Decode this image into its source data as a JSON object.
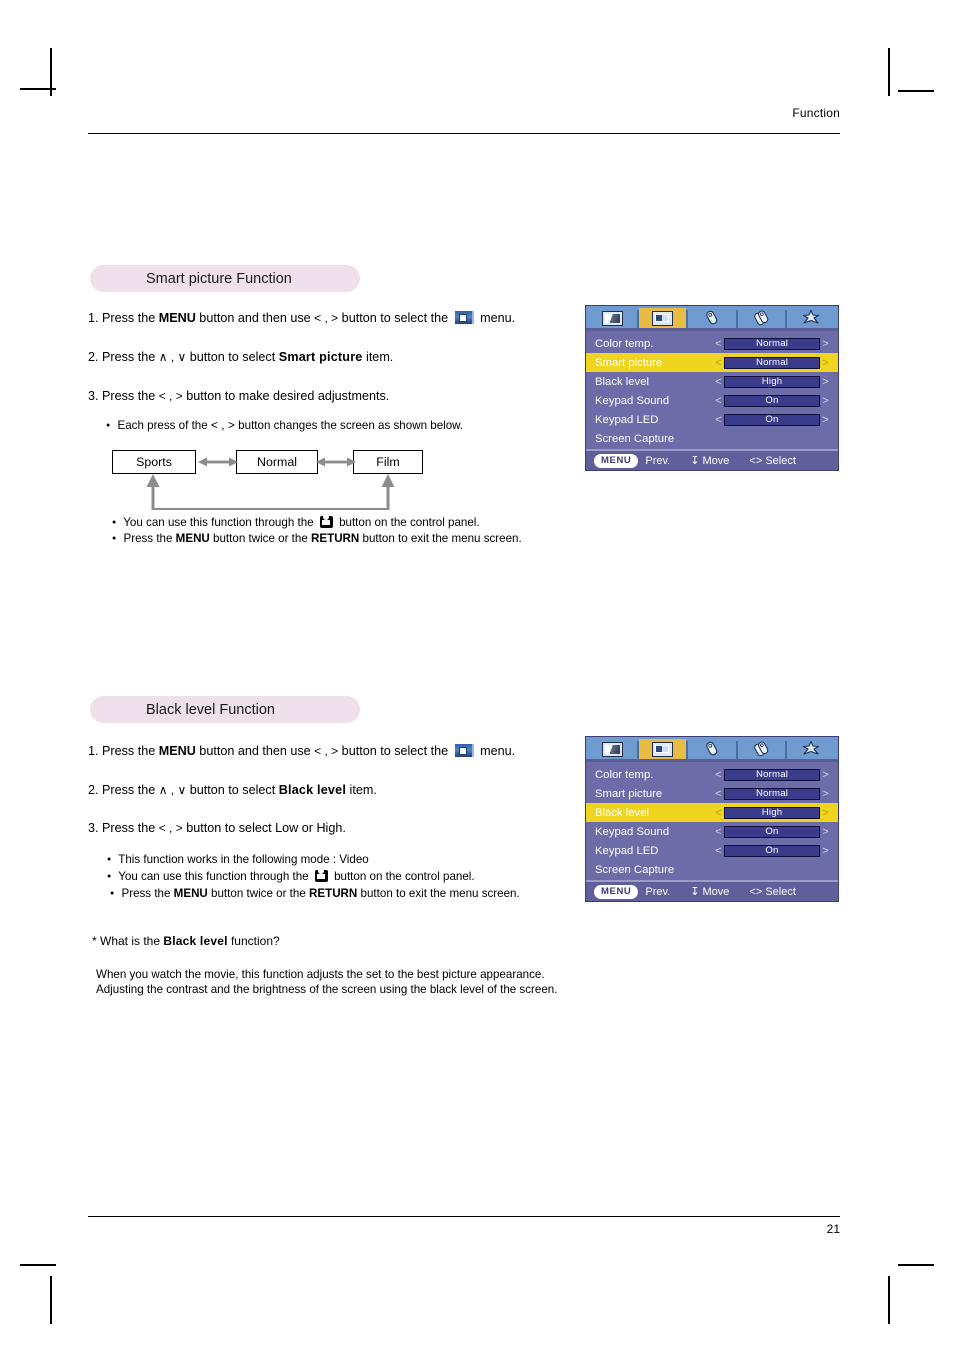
{
  "page": {
    "header_title": "Function",
    "page_number": "21"
  },
  "sections": [
    {
      "id": "smart-picture",
      "pill_title": "Smart picture Function",
      "steps": [
        {
          "num": "1.",
          "pre": "Press the ",
          "bold1": "MENU",
          "mid": " button and then use ",
          "arrows": "< , >",
          "post": " button to select the ",
          "icon": "tv-menu-icon",
          "tail": " menu."
        },
        {
          "num": "2.",
          "pre": "Press the  ",
          "arrows": "∧ , ∨",
          "mid": " button to select ",
          "bold1": "Smart picture",
          "tail": " item."
        },
        {
          "num": "3.",
          "pre": "Press the ",
          "arrows": "< , >",
          "tail": " button to make desired adjustments."
        }
      ],
      "sub_bullet": {
        "pre": "Each press of the ",
        "arrows": "< , >",
        "tail": " button changes the screen as shown below."
      },
      "notes": [
        {
          "pre": "You can use this function through the ",
          "icon": "control-panel-button-icon",
          "tail": " button on the control panel."
        },
        {
          "pre": "Press the ",
          "bold1": "MENU",
          "mid": " button twice or the ",
          "bold2": "RETURN",
          "tail": " button to exit the menu screen."
        }
      ]
    },
    {
      "id": "black-level",
      "pill_title": "Black level Function",
      "steps": [
        {
          "num": "1.",
          "pre": "Press the ",
          "bold1": "MENU",
          "mid": " button and then use ",
          "arrows": "< , >",
          "post": " button to select the ",
          "icon": "tv-menu-icon",
          "tail": " menu."
        },
        {
          "num": "2.",
          "pre": "Press the ",
          "arrows": "∧ , ∨",
          "mid": " button to select ",
          "bold1": "Black level",
          "tail": " item."
        },
        {
          "num": "3.",
          "pre": "Press the ",
          "arrows": "< , >",
          "tail": " button to select Low or High."
        }
      ],
      "notes": [
        {
          "pre": "This function works in the following mode : Video"
        },
        {
          "pre": "You can use this function through the ",
          "icon": "control-panel-button-icon",
          "tail": " button on the control panel."
        },
        {
          "pre": "Press the ",
          "bold1": "MENU",
          "mid": " button twice or the ",
          "bold2": "RETURN",
          "tail": " button to exit the menu screen."
        }
      ]
    }
  ],
  "flow_diagram": {
    "boxes": [
      "Sports",
      "Normal",
      "Film"
    ]
  },
  "explainer": {
    "question_pre": "* What is the ",
    "question_bold": "Black level",
    "question_post": " function?",
    "body": "When you watch the movie, this function adjusts the set to the best picture appearance. Adjusting the contrast and the brightness of the screen using the black level of the screen."
  },
  "osd": {
    "tabs": [
      {
        "icon": "screen-icon",
        "active": false
      },
      {
        "icon": "picture-icon",
        "active": true
      },
      {
        "icon": "sound-icon",
        "active": false
      },
      {
        "icon": "audio-icon",
        "active": false
      },
      {
        "icon": "special-icon",
        "active": false
      }
    ],
    "left_arrow": "<",
    "right_arrow": ">",
    "footer": {
      "menu_chip": "MENU",
      "prev": "Prev.",
      "move_glyph": "↧",
      "move": "Move",
      "select_glyph": "<>",
      "select": "Select"
    },
    "panel_smart": {
      "rows": [
        {
          "label": "Color temp.",
          "value": "Normal",
          "selected": false
        },
        {
          "label": "Smart picture",
          "value": "Normal",
          "selected": true
        },
        {
          "label": "Black level",
          "value": "High",
          "selected": false
        },
        {
          "label": "Keypad Sound",
          "value": "On",
          "selected": false
        },
        {
          "label": "Keypad LED",
          "value": "On",
          "selected": false
        },
        {
          "label": "Screen Capture",
          "value": "",
          "selected": false
        }
      ]
    },
    "panel_black": {
      "rows": [
        {
          "label": "Color temp.",
          "value": "Normal",
          "selected": false
        },
        {
          "label": "Smart picture",
          "value": "Normal",
          "selected": false
        },
        {
          "label": "Black level",
          "value": "High",
          "selected": true
        },
        {
          "label": "Keypad Sound",
          "value": "On",
          "selected": false
        },
        {
          "label": "Keypad LED",
          "value": "On",
          "selected": false
        },
        {
          "label": "Screen Capture",
          "value": "",
          "selected": false
        }
      ]
    }
  },
  "colors": {
    "pill": "#f0e0ec",
    "osd_bg": "#6c6ca8",
    "osd_tabbar": "#6f9bd1",
    "osd_highlight": "#efd51f",
    "osd_tab_active": "#e8bb45",
    "osd_valuebox": "#3b3b8c",
    "osd_footer": "#5f5f9c"
  }
}
